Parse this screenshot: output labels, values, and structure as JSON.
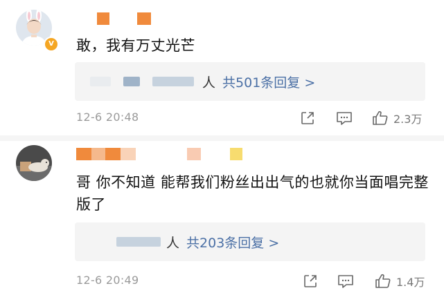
{
  "comments": [
    {
      "text": "敢，我有万丈光芒",
      "reply_suffix": "人",
      "reply_link": "共501条回复 >",
      "timestamp": "12-6 20:48",
      "like_count": "2.3万"
    },
    {
      "text": "哥 你不知道 能帮我们粉丝出出气的也就你当面唱完整版了",
      "reply_suffix": "人",
      "reply_link": "共203条回复 >",
      "timestamp": "12-6 20:49",
      "like_count": "1.4万"
    }
  ],
  "colors": {
    "background": "#ffffff",
    "reply_box": "#f4f4f4",
    "link": "#4a6fa5",
    "meta_text": "#9a9a9a",
    "verified_badge": "#f5a623",
    "redaction_orange": "#f08a3c",
    "redaction_blue": "#9fb3c8"
  },
  "icons": [
    "share-icon",
    "comment-icon",
    "like-icon"
  ]
}
